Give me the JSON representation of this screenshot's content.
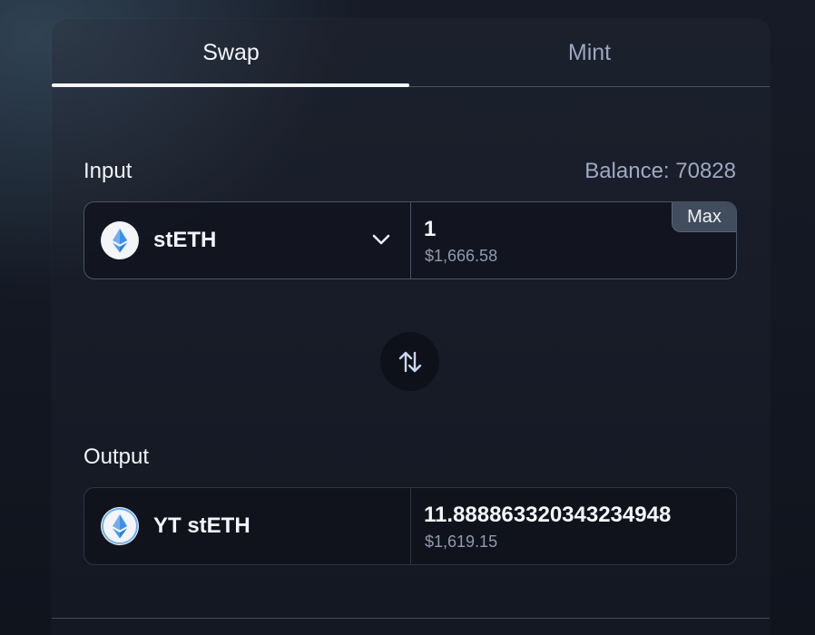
{
  "tabs": [
    {
      "label": "Swap",
      "active": true
    },
    {
      "label": "Mint",
      "active": false
    }
  ],
  "input": {
    "label": "Input",
    "balance_text": "Balance: 70828",
    "token": {
      "symbol": "stETH",
      "icon": "steth-logo-icon"
    },
    "amount": "1",
    "usd_value": "$1,666.58",
    "max_label": "Max"
  },
  "switch_icon": "swap-arrows-icon",
  "output": {
    "label": "Output",
    "token": {
      "symbol": "YT stETH",
      "icon": "steth-logo-icon"
    },
    "amount": "11.888863320343234948",
    "usd_value": "$1,619.15"
  },
  "colors": {
    "active_tab_text": "#f2f5fa",
    "inactive_tab_text": "#9aa6bf",
    "balance_text": "#9ea9c2",
    "logo_blue": "#4a9bf0"
  }
}
